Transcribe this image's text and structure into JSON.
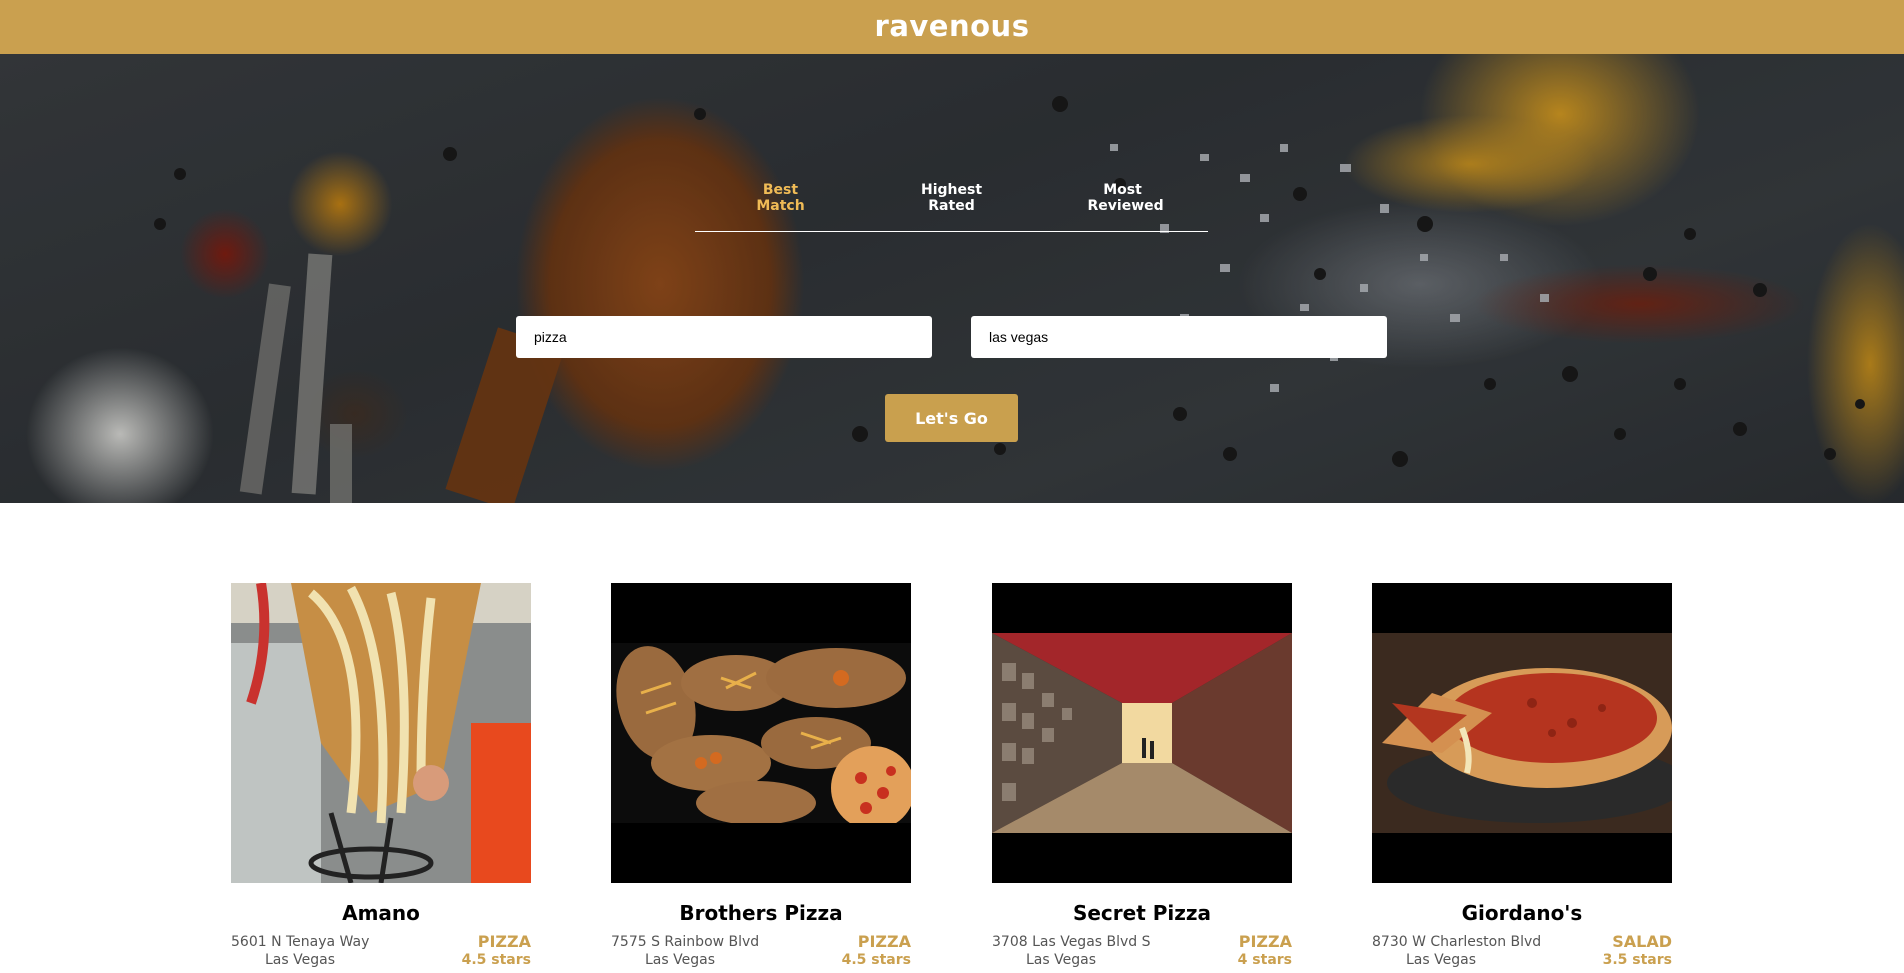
{
  "header": {
    "brand": "ravenous"
  },
  "search": {
    "sort_options": [
      {
        "line1": "Best",
        "line2": "Match",
        "active": true
      },
      {
        "line1": "Highest",
        "line2": "Rated",
        "active": false
      },
      {
        "line1": "Most",
        "line2": "Reviewed",
        "active": false
      }
    ],
    "term_value": "pizza",
    "location_value": "las vegas",
    "submit_label": "Let's Go"
  },
  "businesses": [
    {
      "name": "Amano",
      "address": "5601 N Tenaya Way",
      "city": "Las Vegas",
      "category": "PIZZA",
      "rating": "4.5 stars"
    },
    {
      "name": "Brothers Pizza",
      "address": "7575 S Rainbow Blvd",
      "city": "Las Vegas",
      "category": "PIZZA",
      "rating": "4.5 stars"
    },
    {
      "name": "Secret Pizza",
      "address": "3708 Las Vegas Blvd S",
      "city": "Las Vegas",
      "category": "PIZZA",
      "rating": "4 stars"
    },
    {
      "name": "Giordano's",
      "address": "8730 W Charleston Blvd",
      "city": "Las Vegas",
      "category": "SALAD",
      "rating": "3.5 stars"
    }
  ],
  "colors": {
    "brand": "#caa04f",
    "active_sort": "#f0bb56"
  }
}
